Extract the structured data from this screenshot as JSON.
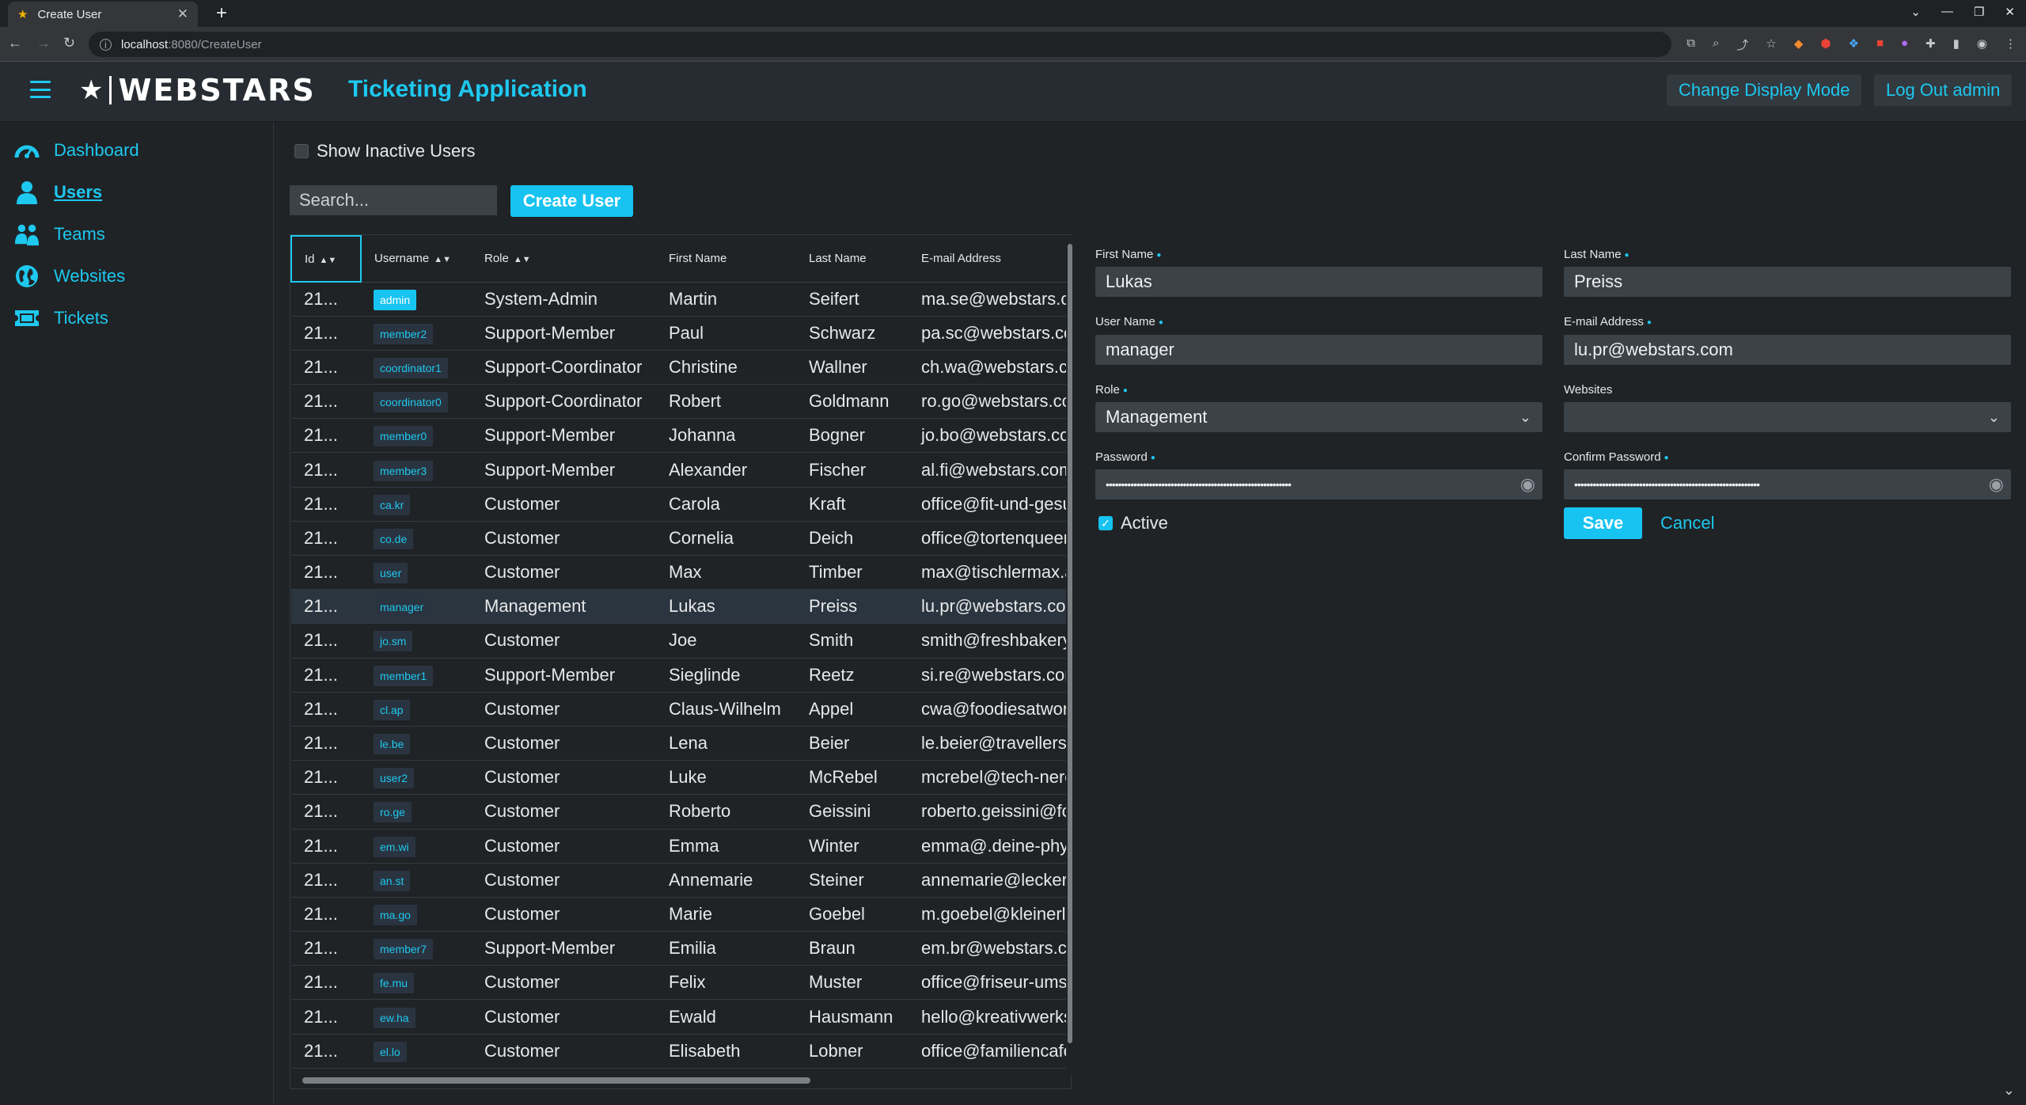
{
  "browser": {
    "tab_title": "Create User",
    "url_host": "localhost",
    "url_path": ":8080/CreateUser"
  },
  "header": {
    "brand": "WEBSTARS",
    "app_title": "Ticketing Application",
    "display_mode_label": "Change Display Mode",
    "logout_label": "Log Out admin"
  },
  "sidebar": {
    "items": [
      {
        "label": "Dashboard",
        "icon": "dashboard-icon"
      },
      {
        "label": "Users",
        "icon": "user-icon"
      },
      {
        "label": "Teams",
        "icon": "teams-icon"
      },
      {
        "label": "Websites",
        "icon": "globe-icon"
      },
      {
        "label": "Tickets",
        "icon": "ticket-icon"
      }
    ]
  },
  "toolbar": {
    "show_inactive_label": "Show Inactive Users",
    "search_placeholder": "Search...",
    "create_user_label": "Create User"
  },
  "table": {
    "columns": [
      "Id",
      "Username",
      "Role",
      "First Name",
      "Last Name",
      "E-mail Address"
    ],
    "rows": [
      {
        "id": "21...",
        "username": "admin",
        "role": "System-Admin",
        "first": "Martin",
        "last": "Seifert",
        "email": "ma.se@webstars.c"
      },
      {
        "id": "21...",
        "username": "member2",
        "role": "Support-Member",
        "first": "Paul",
        "last": "Schwarz",
        "email": "pa.sc@webstars.cc"
      },
      {
        "id": "21...",
        "username": "coordinator1",
        "role": "Support-Coordinator",
        "first": "Christine",
        "last": "Wallner",
        "email": "ch.wa@webstars.c"
      },
      {
        "id": "21...",
        "username": "coordinator0",
        "role": "Support-Coordinator",
        "first": "Robert",
        "last": "Goldmann",
        "email": "ro.go@webstars.cc"
      },
      {
        "id": "21...",
        "username": "member0",
        "role": "Support-Member",
        "first": "Johanna",
        "last": "Bogner",
        "email": "jo.bo@webstars.co"
      },
      {
        "id": "21...",
        "username": "member3",
        "role": "Support-Member",
        "first": "Alexander",
        "last": "Fischer",
        "email": "al.fi@webstars.com"
      },
      {
        "id": "21...",
        "username": "ca.kr",
        "role": "Customer",
        "first": "Carola",
        "last": "Kraft",
        "email": "office@fit-und-gesu"
      },
      {
        "id": "21...",
        "username": "co.de",
        "role": "Customer",
        "first": "Cornelia",
        "last": "Deich",
        "email": "office@tortenqueer"
      },
      {
        "id": "21...",
        "username": "user",
        "role": "Customer",
        "first": "Max",
        "last": "Timber",
        "email": "max@tischlermax.a"
      },
      {
        "id": "21...",
        "username": "manager",
        "role": "Management",
        "first": "Lukas",
        "last": "Preiss",
        "email": "lu.pr@webstars.cor"
      },
      {
        "id": "21...",
        "username": "jo.sm",
        "role": "Customer",
        "first": "Joe",
        "last": "Smith",
        "email": "smith@freshbakery"
      },
      {
        "id": "21...",
        "username": "member1",
        "role": "Support-Member",
        "first": "Sieglinde",
        "last": "Reetz",
        "email": "si.re@webstars.cor"
      },
      {
        "id": "21...",
        "username": "cl.ap",
        "role": "Customer",
        "first": "Claus-Wilhelm",
        "last": "Appel",
        "email": "cwa@foodiesatwor"
      },
      {
        "id": "21...",
        "username": "le.be",
        "role": "Customer",
        "first": "Lena",
        "last": "Beier",
        "email": "le.beier@travellers."
      },
      {
        "id": "21...",
        "username": "user2",
        "role": "Customer",
        "first": "Luke",
        "last": "McRebel",
        "email": "mcrebel@tech-nerc"
      },
      {
        "id": "21...",
        "username": "ro.ge",
        "role": "Customer",
        "first": "Roberto",
        "last": "Geissini",
        "email": "roberto.geissini@fc"
      },
      {
        "id": "21...",
        "username": "em.wi",
        "role": "Customer",
        "first": "Emma",
        "last": "Winter",
        "email": "emma@.deine-phy"
      },
      {
        "id": "21...",
        "username": "an.st",
        "role": "Customer",
        "first": "Annemarie",
        "last": "Steiner",
        "email": "annemarie@lecker"
      },
      {
        "id": "21...",
        "username": "ma.go",
        "role": "Customer",
        "first": "Marie",
        "last": "Goebel",
        "email": "m.goebel@kleinerla"
      },
      {
        "id": "21...",
        "username": "member7",
        "role": "Support-Member",
        "first": "Emilia",
        "last": "Braun",
        "email": "em.br@webstars.c"
      },
      {
        "id": "21...",
        "username": "fe.mu",
        "role": "Customer",
        "first": "Felix",
        "last": "Muster",
        "email": "office@friseur-ums"
      },
      {
        "id": "21...",
        "username": "ew.ha",
        "role": "Customer",
        "first": "Ewald",
        "last": "Hausmann",
        "email": "hello@kreativwerks"
      },
      {
        "id": "21...",
        "username": "el.lo",
        "role": "Customer",
        "first": "Elisabeth",
        "last": "Lobner",
        "email": "office@familiencafe"
      }
    ]
  },
  "form": {
    "first_name_label": "First Name",
    "first_name_value": "Lukas",
    "last_name_label": "Last Name",
    "last_name_value": "Preiss",
    "username_label": "User Name",
    "username_value": "manager",
    "email_label": "E-mail Address",
    "email_value": "lu.pr@webstars.com",
    "role_label": "Role",
    "role_value": "Management",
    "websites_label": "Websites",
    "websites_value": "",
    "password_label": "Password",
    "password_value": "••••••••••••••••••••••••••••••••••••••••••••••••••••••••••••",
    "confirm_label": "Confirm Password",
    "confirm_value": "••••••••••••••••••••••••••••••••••••••••••••••••••••••••••••",
    "active_label": "Active",
    "save_label": "Save",
    "cancel_label": "Cancel"
  },
  "colors": {
    "accent": "#17c3f0",
    "background": "#1f2326",
    "header": "#262c31",
    "input": "#3b4248"
  }
}
